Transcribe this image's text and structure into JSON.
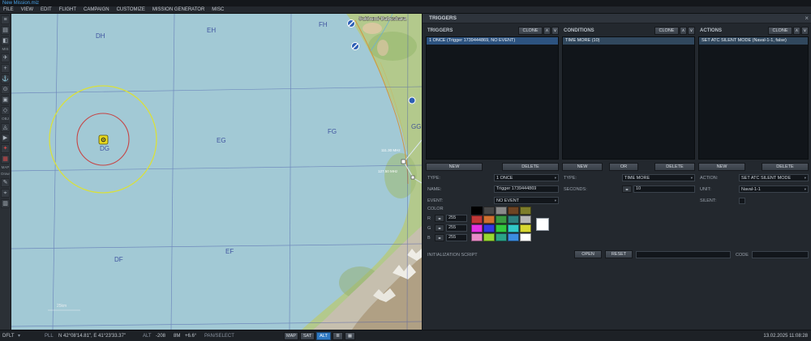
{
  "title_bar": {
    "title": "New Mission.miz"
  },
  "menu": {
    "items": [
      "FILE",
      "VIEW",
      "EDIT",
      "FLIGHT",
      "CAMPAIGN",
      "CUSTOMIZE",
      "MISSION GENERATOR",
      "MISC"
    ]
  },
  "toolbar": {
    "items": [
      {
        "type": "icon",
        "glyph": "≡",
        "name": "main-menu"
      },
      {
        "type": "icon",
        "glyph": "▤",
        "name": "file"
      },
      {
        "type": "icon",
        "glyph": "◧",
        "name": "view-options"
      },
      {
        "type": "label",
        "text": "MIS",
        "name": "section-mission"
      },
      {
        "type": "icon",
        "glyph": "✈",
        "name": "add-airplane"
      },
      {
        "type": "icon",
        "glyph": "+",
        "name": "add-helicopter"
      },
      {
        "type": "icon",
        "glyph": "⚓",
        "name": "add-ship"
      },
      {
        "type": "icon",
        "glyph": "⊙",
        "name": "add-vehicle"
      },
      {
        "type": "icon",
        "glyph": "▣",
        "name": "add-static-object"
      },
      {
        "type": "icon",
        "glyph": "◇",
        "name": "add-template"
      },
      {
        "type": "label",
        "text": "OBJ",
        "name": "section-objects"
      },
      {
        "type": "icon",
        "glyph": "◬",
        "name": "add-trigger-zone"
      },
      {
        "type": "icon",
        "glyph": "▶",
        "name": "add-waypoint"
      },
      {
        "type": "icon",
        "glyph": "✦",
        "name": "bullseye",
        "color": "#d04a4a"
      },
      {
        "type": "icon",
        "glyph": "▦",
        "name": "grid-overlay",
        "color": "#d04a4a"
      },
      {
        "type": "label",
        "text": "MAP",
        "name": "section-map"
      },
      {
        "type": "label",
        "text": "Draw",
        "name": "section-draw"
      },
      {
        "type": "icon",
        "glyph": "✎",
        "name": "draw-tool"
      },
      {
        "type": "icon",
        "glyph": "⌖",
        "name": "ruler"
      },
      {
        "type": "icon",
        "glyph": "▥",
        "name": "map-layers"
      }
    ]
  },
  "map": {
    "airfield_label": "Sukhumi-Babushara",
    "grid_labels": [
      "DH",
      "EH",
      "FH",
      "DG",
      "EG",
      "FG",
      "GG",
      "DF",
      "EF"
    ],
    "freq_labels": [
      "111.30 MHz",
      "127.50 MHz"
    ],
    "scale_label": "25km"
  },
  "panel": {
    "title": "TRIGGERS",
    "columns": [
      {
        "header": "TRIGGERS",
        "clone_label": "CLONE",
        "items": [
          "1 ONCE (Trigger 1739444869, NO EVENT)"
        ],
        "new_label": "NEW",
        "delete_label": "DELETE"
      },
      {
        "header": "CONDITIONS",
        "clone_label": "CLONE",
        "items": [
          "TIME MORE (10)"
        ],
        "new_label": "NEW",
        "or_label": "OR",
        "delete_label": "DELETE"
      },
      {
        "header": "ACTIONS",
        "clone_label": "CLONE",
        "items": [
          "SET ATC SILENT MODE (Naval-1-1, false)"
        ],
        "new_label": "NEW",
        "delete_label": "DELETE"
      }
    ],
    "form": {
      "type_label": "TYPE:",
      "type_value": "1 ONCE",
      "name_label": "NAME:",
      "name_value": "Trigger 1739444869",
      "event_label": "EVENT:",
      "event_value": "NO EVENT",
      "cond_type_label": "TYPE:",
      "cond_type_value": "TIME MORE",
      "seconds_label": "SECONDS:",
      "seconds_value": "10",
      "action_label": "ACTION:",
      "action_value": "SET ATC SILENT MODE",
      "unit_label": "UNIT:",
      "unit_value": "Naval-1-1",
      "silent_label": "SILENT:"
    },
    "color_section": {
      "label": "COLOR",
      "channels": [
        {
          "label": "R",
          "value": "255"
        },
        {
          "label": "G",
          "value": "255"
        },
        {
          "label": "B",
          "value": "255"
        }
      ],
      "palette": [
        "#000000",
        "#474747",
        "#8a8a8a",
        "#6e4423",
        "#7d7d2a",
        "#c03838",
        "#d07030",
        "#3a9a40",
        "#2e8080",
        "#b8b8b8",
        "#e332e3",
        "#3238e3",
        "#32c93e",
        "#32c9c9",
        "#d8d832",
        "#e88cc8",
        "#98d832",
        "#2ba388",
        "#3c8ce0",
        "#ffffff"
      ],
      "selected": "#ffffff"
    },
    "init_script": {
      "label": "INITIALIZATION SCRIPT",
      "open_label": "OPEN",
      "reset_label": "RESET",
      "code_label": "CODE",
      "script_value": "",
      "code_value": ""
    }
  },
  "status_bar": {
    "profile": "DFLT",
    "coord_label": "PLL",
    "coord_value": "N 42°08'14.81\", E 41°23'33.37\"",
    "alt_label": "ALT",
    "alt_value": "-208",
    "scale": "8M",
    "heading": "+6.6°",
    "mode": "PAN/SELECT",
    "map_label": "MAP",
    "sat_label": "SAT",
    "alt_btn_label": "ALT",
    "datetime": "13.02.2025 11:08:28"
  },
  "icons": {
    "close": "×",
    "chevron_up": "∧",
    "chevron_down": "∨",
    "dropdown_caret": "▾",
    "stepper": "◂▸",
    "profile_caret": "▾",
    "layers": "≣",
    "measure": "▦"
  },
  "colors": {
    "accent_blue": "#2f79c2",
    "selected_row": "#2d5380",
    "title_blue": "#4aa3e8",
    "map_water": "#a2c9d5",
    "map_land": "#b3c98c",
    "zone_circle_yellow": "#d9e03c",
    "zone_circle_red": "#c64545"
  }
}
